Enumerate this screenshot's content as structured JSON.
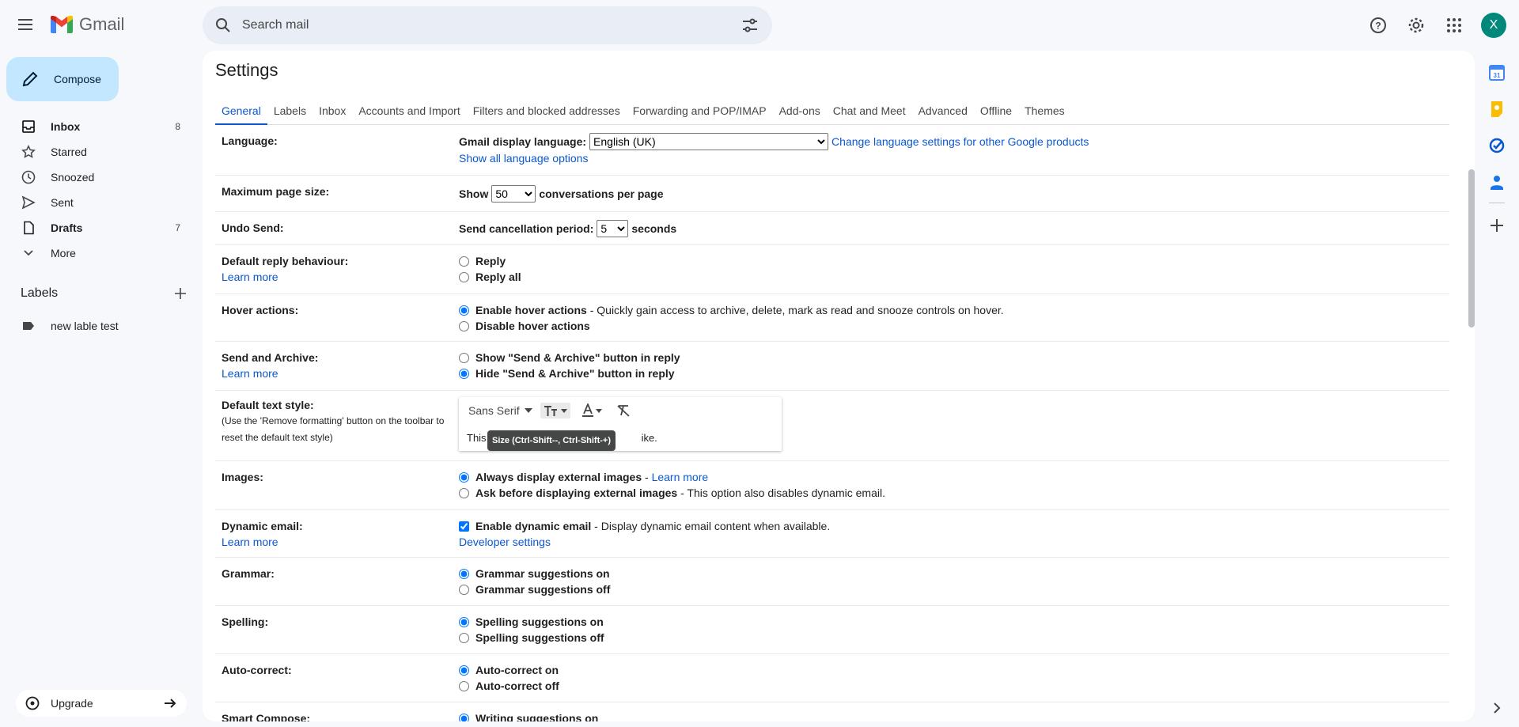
{
  "header": {
    "logo_text": "Gmail",
    "search_placeholder": "Search mail",
    "avatar_letter": "X"
  },
  "compose": {
    "label": "Compose"
  },
  "nav": {
    "items": [
      {
        "label": "Inbox",
        "count": "8",
        "icon": "inbox-icon",
        "bold": true
      },
      {
        "label": "Starred",
        "count": "",
        "icon": "star-icon",
        "bold": false
      },
      {
        "label": "Snoozed",
        "count": "",
        "icon": "clock-icon",
        "bold": false
      },
      {
        "label": "Sent",
        "count": "",
        "icon": "send-icon",
        "bold": false
      },
      {
        "label": "Drafts",
        "count": "7",
        "icon": "draft-icon",
        "bold": true
      },
      {
        "label": "More",
        "count": "",
        "icon": "chevron-down-icon",
        "bold": false
      }
    ]
  },
  "labels": {
    "title": "Labels",
    "items": [
      {
        "label": "new lable test"
      }
    ]
  },
  "upgrade": {
    "label": "Upgrade"
  },
  "settings": {
    "title": "Settings",
    "tabs": [
      "General",
      "Labels",
      "Inbox",
      "Accounts and Import",
      "Filters and blocked addresses",
      "Forwarding and POP/IMAP",
      "Add-ons",
      "Chat and Meet",
      "Advanced",
      "Offline",
      "Themes"
    ],
    "language": {
      "label": "Language:",
      "display_label": "Gmail display language:",
      "value": "English (UK)",
      "change_link": "Change language settings for other Google products",
      "show_all": "Show all language options"
    },
    "page_size": {
      "label": "Maximum page size:",
      "prefix": "Show",
      "value": "50",
      "suffix": "conversations per page"
    },
    "undo_send": {
      "label": "Undo Send:",
      "prefix": "Send cancellation period:",
      "value": "5",
      "suffix": "seconds"
    },
    "reply": {
      "label": "Default reply behaviour:",
      "learn_more": "Learn more",
      "opt1": "Reply",
      "opt2": "Reply all"
    },
    "hover": {
      "label": "Hover actions:",
      "opt1": "Enable hover actions",
      "opt1_desc": " - Quickly gain access to archive, delete, mark as read and snooze controls on hover.",
      "opt2": "Disable hover actions"
    },
    "send_archive": {
      "label": "Send and Archive:",
      "learn_more": "Learn more",
      "opt1": "Show \"Send & Archive\" button in reply",
      "opt2": "Hide \"Send & Archive\" button in reply"
    },
    "text_style": {
      "label": "Default text style:",
      "sub": "(Use the 'Remove formatting' button on the toolbar to reset the default text style)",
      "font": "Sans Serif",
      "preview_start": "This",
      "preview_end": "ike.",
      "tooltip": "Size (Ctrl-Shift--, Ctrl-Shift-+)"
    },
    "images": {
      "label": "Images:",
      "opt1": "Always display external images",
      "opt1_sep": " - ",
      "opt1_link": "Learn more",
      "opt2": "Ask before displaying external images",
      "opt2_desc": " - This option also disables dynamic email."
    },
    "dynamic": {
      "label": "Dynamic email:",
      "learn_more": "Learn more",
      "opt1": "Enable dynamic email",
      "opt1_desc": " - Display dynamic email content when available.",
      "dev_link": "Developer settings"
    },
    "grammar": {
      "label": "Grammar:",
      "opt1": "Grammar suggestions on",
      "opt2": "Grammar suggestions off"
    },
    "spelling": {
      "label": "Spelling:",
      "opt1": "Spelling suggestions on",
      "opt2": "Spelling suggestions off"
    },
    "autocorrect": {
      "label": "Auto-correct:",
      "opt1": "Auto-correct on",
      "opt2": "Auto-correct off"
    },
    "smart_compose": {
      "label": "Smart Compose:",
      "opt1": "Writing suggestions on"
    }
  },
  "colors": {
    "accent": "#0b57d0",
    "compose_bg": "#c2e7ff",
    "page_bg": "#f6f8fc"
  }
}
